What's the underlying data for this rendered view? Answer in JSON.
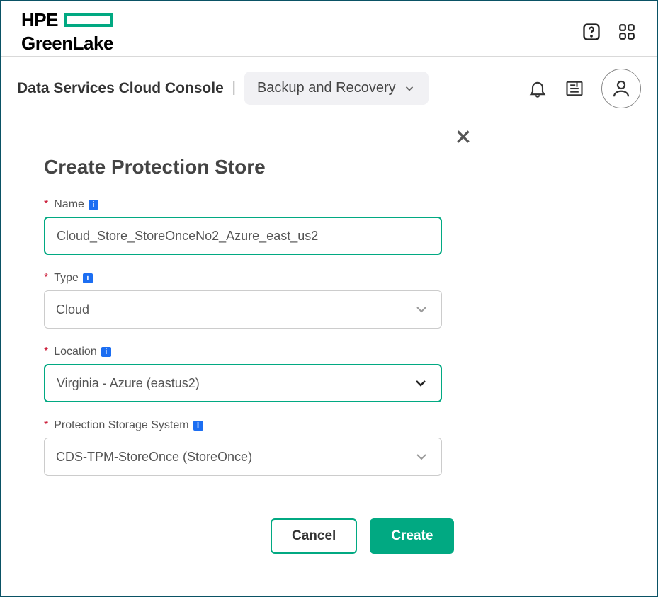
{
  "brand": {
    "hpe": "HPE",
    "greenlake": "GreenLake"
  },
  "subheader": {
    "console_title": "Data Services Cloud Console",
    "dropdown_label": "Backup and Recovery"
  },
  "modal": {
    "title": "Create Protection Store",
    "fields": {
      "name": {
        "label": "Name",
        "value": "Cloud_Store_StoreOnceNo2_Azure_east_us2"
      },
      "type": {
        "label": "Type",
        "value": "Cloud"
      },
      "location": {
        "label": "Location",
        "value": "Virginia - Azure (eastus2)"
      },
      "storage_system": {
        "label": "Protection Storage System",
        "value": "CDS-TPM-StoreOnce (StoreOnce)"
      }
    },
    "buttons": {
      "cancel": "Cancel",
      "create": "Create"
    }
  },
  "icons": {
    "info": "i"
  }
}
